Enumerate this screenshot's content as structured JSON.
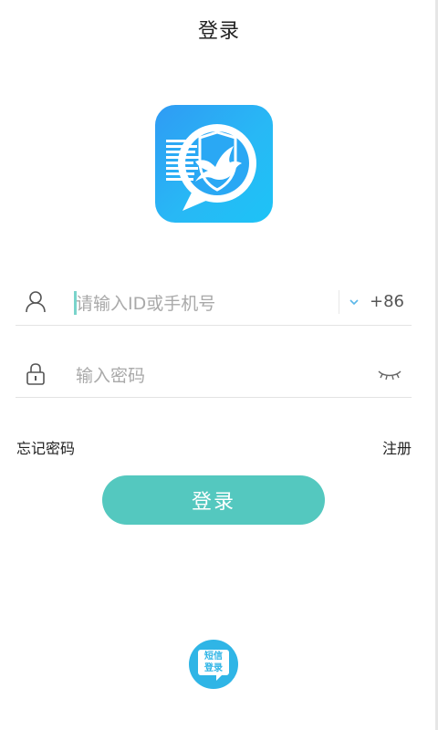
{
  "header": {
    "title": "登录"
  },
  "form": {
    "account": {
      "placeholder": "请输入ID或手机号",
      "value": "",
      "country_code": "+86"
    },
    "password": {
      "placeholder": "输入密码",
      "value": ""
    }
  },
  "links": {
    "forgot_password": "忘记密码",
    "register": "注册"
  },
  "login_button": {
    "label": "登录"
  },
  "sms_login": {
    "line1": "短信",
    "line2": "登录"
  },
  "icons": {
    "logo": "chat-shield-dove-icon",
    "user": "user-icon",
    "lock": "lock-icon",
    "dropdown": "chevron-down-icon",
    "eye": "eye-closed-icon"
  },
  "colors": {
    "primary": "#54c8bf",
    "logo_gradient_start": "#2f9bf4",
    "logo_gradient_end": "#1dc3f6",
    "sms_button": "#2fb5e6"
  }
}
